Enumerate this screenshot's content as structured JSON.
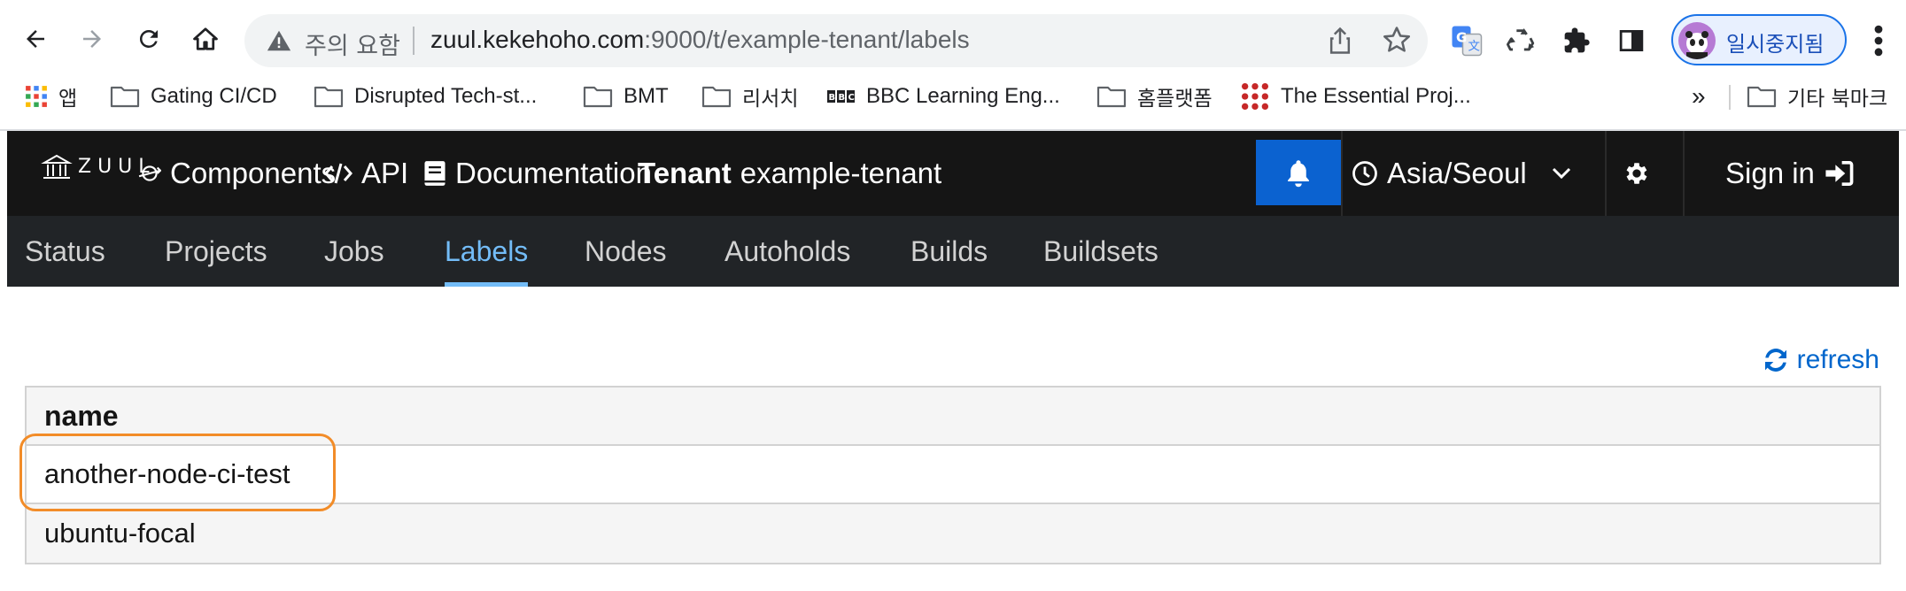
{
  "browser": {
    "omnibox": {
      "security_label": "주의 요함",
      "url_host": "zuul.kekehoho.com",
      "url_rest": ":9000/t/example-tenant/labels"
    },
    "profile": {
      "label": "일시중지됨"
    },
    "bookmarks": [
      {
        "label": "앱",
        "icon": "apps-grid-icon"
      },
      {
        "label": "Gating CI/CD",
        "icon": "folder-icon"
      },
      {
        "label": "Disrupted Tech-st...",
        "icon": "folder-icon"
      },
      {
        "label": "BMT",
        "icon": "folder-icon"
      },
      {
        "label": "리서치",
        "icon": "folder-icon"
      },
      {
        "label": "BBC Learning Eng...",
        "icon": "bbc-icon"
      },
      {
        "label": "홈플랫폼",
        "icon": "folder-icon"
      },
      {
        "label": "The Essential Proj...",
        "icon": "dots-grid-icon"
      }
    ],
    "overflow_chevron": "»",
    "other_bookmarks": "기타 북마크"
  },
  "header": {
    "logo_text": "ZUUL",
    "components": "Components",
    "api": "API",
    "documentation": "Documentation",
    "tenant_label": "Tenant",
    "tenant_name": "example-tenant",
    "timezone": "Asia/Seoul",
    "sign_in": "Sign in"
  },
  "tabs": [
    {
      "label": "Status",
      "active": false
    },
    {
      "label": "Projects",
      "active": false
    },
    {
      "label": "Jobs",
      "active": false
    },
    {
      "label": "Labels",
      "active": true
    },
    {
      "label": "Nodes",
      "active": false
    },
    {
      "label": "Autoholds",
      "active": false
    },
    {
      "label": "Builds",
      "active": false
    },
    {
      "label": "Buildsets",
      "active": false
    }
  ],
  "content": {
    "refresh_label": "refresh",
    "table": {
      "header": "name",
      "rows": [
        "another-node-ci-test",
        "ubuntu-focal"
      ]
    }
  },
  "colors": {
    "header_bg": "#151515",
    "tabs_bg": "#212427",
    "active_tab": "#73bcf7",
    "bell_button": "#0b62d0",
    "link": "#0066cc",
    "highlight": "#f28c28"
  }
}
